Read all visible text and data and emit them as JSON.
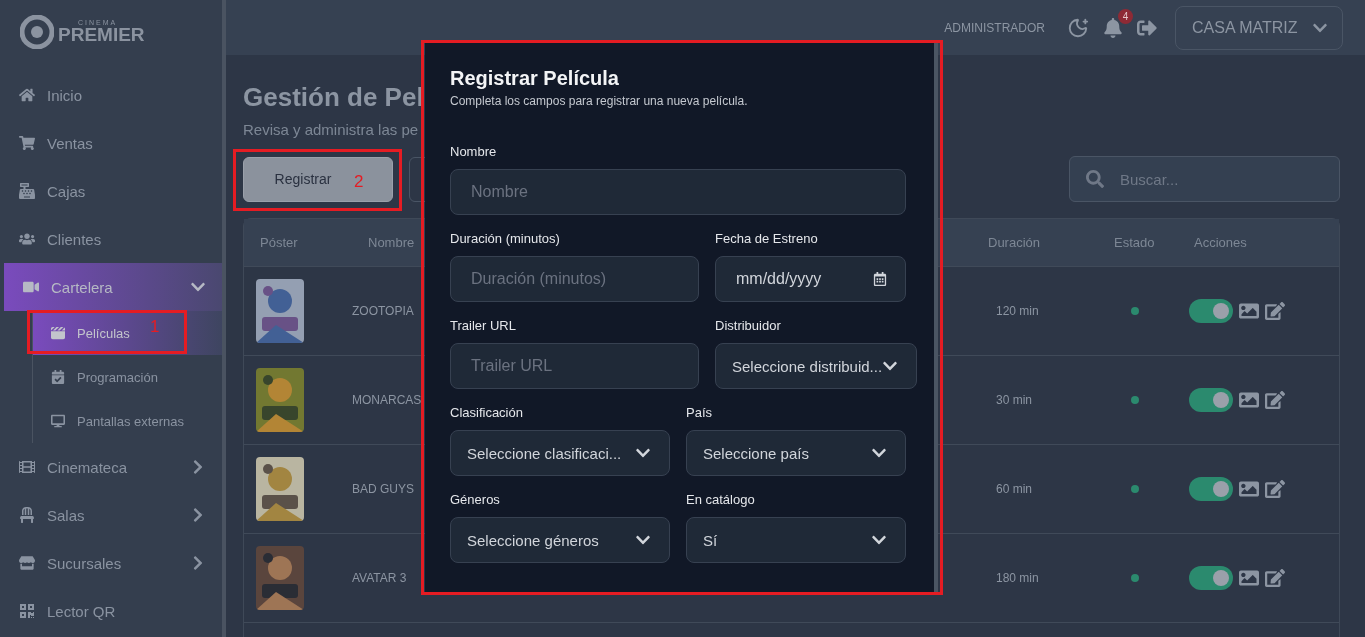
{
  "logo": {
    "small": "CINEMA",
    "name": "PREMIER"
  },
  "sidebar": {
    "items": [
      {
        "label": "Inicio",
        "selected": false
      },
      {
        "label": "Ventas",
        "selected": false
      },
      {
        "label": "Cajas",
        "selected": false
      },
      {
        "label": "Clientes",
        "selected": false
      },
      {
        "label": "Cartelera",
        "selected": true,
        "expanded": true,
        "children": [
          {
            "label": "Películas",
            "selected": true
          },
          {
            "label": "Programación",
            "selected": false
          },
          {
            "label": "Pantallas externas",
            "selected": false
          }
        ]
      },
      {
        "label": "Cinemateca",
        "selected": false,
        "expanded": false
      },
      {
        "label": "Salas",
        "selected": false,
        "expanded": false
      },
      {
        "label": "Sucursales",
        "selected": false,
        "expanded": false
      },
      {
        "label": "Lector QR",
        "selected": false
      }
    ]
  },
  "header": {
    "role": "ADMINISTRADOR",
    "notifications": "4",
    "branch": "CASA MATRIZ"
  },
  "page": {
    "title": "Gestión de Pel",
    "subtitle": "Revisa y administra las pe",
    "primary_button": "Registrar",
    "search": {
      "placeholder": "Buscar..."
    }
  },
  "table": {
    "columns": [
      "Póster",
      "Nombre",
      "Duración",
      "Estado",
      "Acciones"
    ],
    "rows": [
      {
        "name": "ZOOTOPIA",
        "duration": "120 min",
        "active": true,
        "on": true
      },
      {
        "name": "MONARCAS",
        "duration": "30 min",
        "active": true,
        "on": true
      },
      {
        "name": "BAD GUYS",
        "duration": "60 min",
        "active": true,
        "on": true
      },
      {
        "name": "AVATAR 3",
        "duration": "180 min",
        "active": true,
        "on": true
      }
    ]
  },
  "modal": {
    "title": "Registrar Película",
    "subtitle": "Completa los campos para registrar una nueva película.",
    "rows": [
      [
        {
          "label": "Nombre",
          "kind": "text",
          "placeholder": "Nombre"
        }
      ],
      [
        {
          "label": "Duración (minutos)",
          "kind": "text",
          "placeholder": "Duración (minutos)"
        },
        {
          "label": "Fecha de Estreno",
          "kind": "date",
          "value": "mm/dd/yyyy"
        }
      ],
      [
        {
          "label": "Trailer URL",
          "kind": "text",
          "placeholder": "Trailer URL"
        },
        {
          "label": "Distribuidor",
          "kind": "select",
          "value": "Seleccione distribuid..."
        }
      ],
      [
        {
          "label": "Clasificación",
          "kind": "select",
          "value": "Seleccione clasificaci..."
        },
        {
          "label": "País",
          "kind": "select",
          "value": "Seleccione país"
        }
      ],
      [
        {
          "label": "Géneros",
          "kind": "select",
          "value": "Seleccione géneros"
        },
        {
          "label": "En catálogo",
          "kind": "select",
          "value": "Sí"
        }
      ]
    ]
  },
  "annotations": [
    {
      "kind": "numbered",
      "label": "1"
    },
    {
      "kind": "numbered",
      "label": "2"
    },
    {
      "kind": "plain"
    }
  ]
}
